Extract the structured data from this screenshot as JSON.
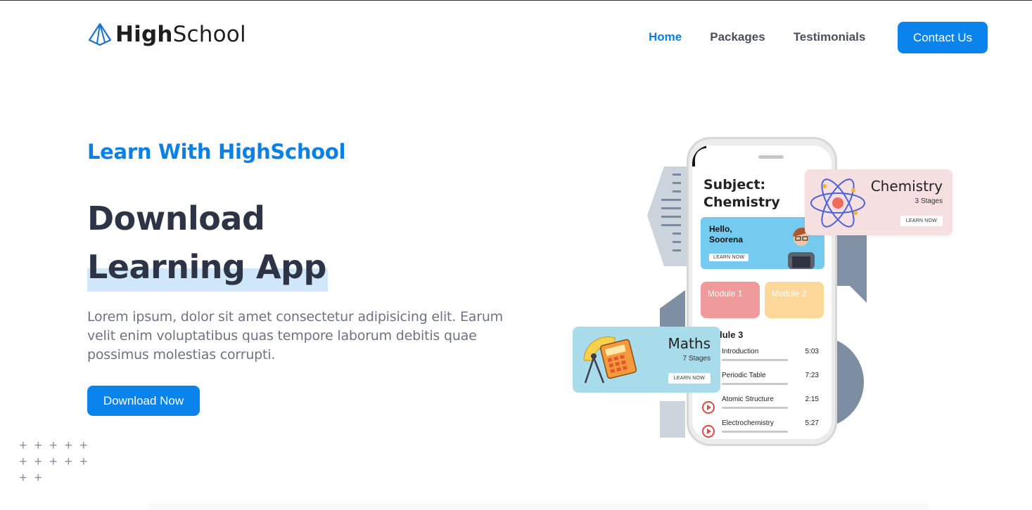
{
  "brand": {
    "name_bold": "High",
    "name_rest": "School"
  },
  "nav": {
    "links": [
      {
        "label": "Home",
        "active": true
      },
      {
        "label": "Packages",
        "active": false
      },
      {
        "label": "Testimonials",
        "active": false
      }
    ],
    "contact_label": "Contact Us"
  },
  "hero": {
    "eyebrow": "Learn With HighSchool",
    "headline_line1": "Download",
    "headline_line2": "Learning App",
    "lead": "Lorem ipsum, dolor sit amet consectetur adipisicing elit. Earum velit enim voluptatibus quas tempore laborum debitis quae possimus molestias corrupti.",
    "download_label": "Download Now"
  },
  "app": {
    "subject_line1": "Subject:",
    "subject_line2": "Chemistry",
    "greeting_line1": "Hello,",
    "greeting_line2": "Soorena",
    "greeting_button": "LEARN NOW",
    "module1": "Module 1",
    "module2": "Module 2",
    "module3": "Module 3",
    "lessons": [
      {
        "title": "Introduction",
        "time": "5:03"
      },
      {
        "title": "Periodic Table",
        "time": "7:23"
      },
      {
        "title": "Atomic Structure",
        "time": "2:15"
      },
      {
        "title": "Electrochemistry",
        "time": "5:27"
      }
    ]
  },
  "cards": {
    "chemistry": {
      "title": "Chemistry",
      "stages": "3 Stages",
      "button": "LEARN NOW"
    },
    "maths": {
      "title": "Maths",
      "stages": "7 Stages",
      "button": "LEARN NOW"
    }
  },
  "colors": {
    "accent": "#0a84ec",
    "heading": "#2c3445",
    "highlight": "#cfe6fb"
  }
}
